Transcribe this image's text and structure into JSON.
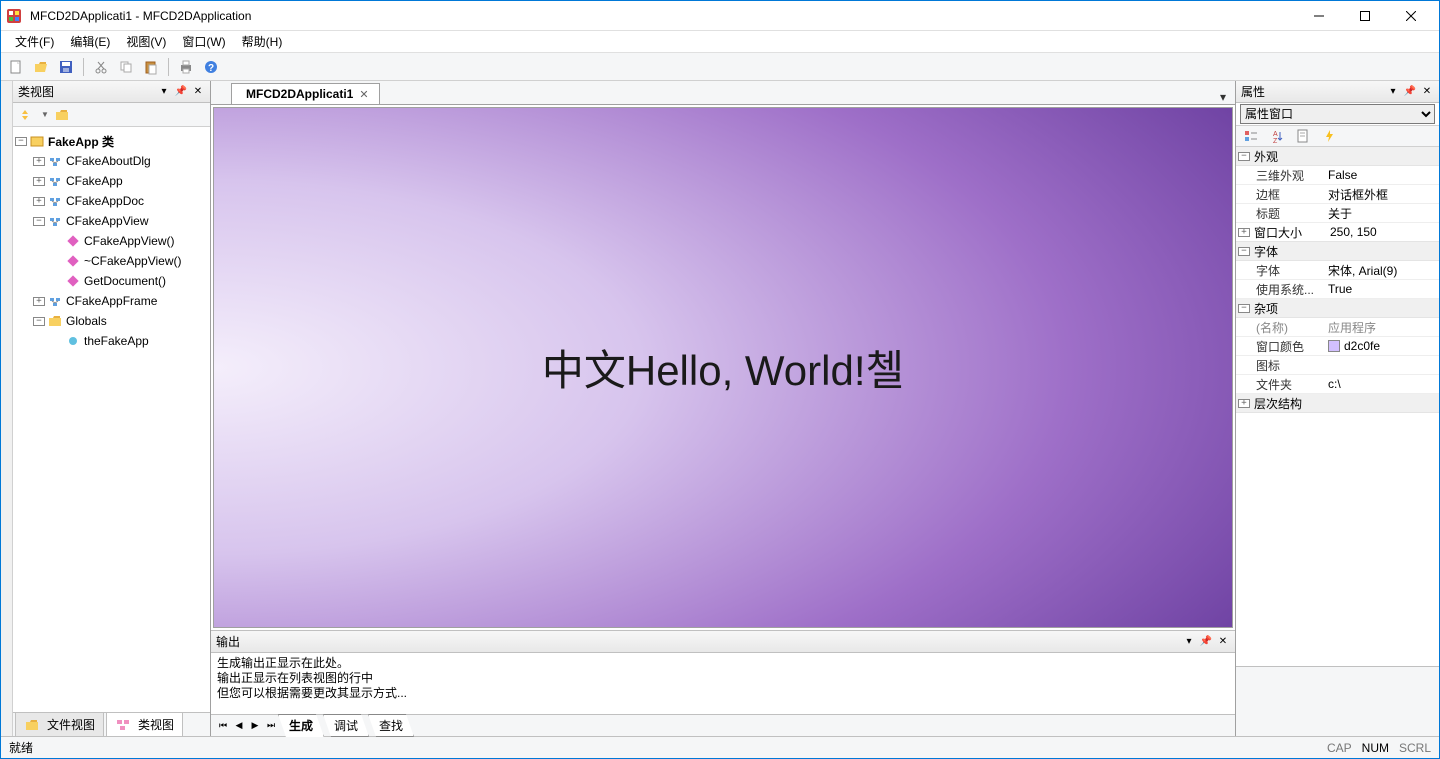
{
  "titlebar": {
    "title": "MFCD2DApplicati1 - MFCD2DApplication"
  },
  "menu": {
    "file": "文件(F)",
    "edit": "编辑(E)",
    "view": "视图(V)",
    "window": "窗口(W)",
    "help": "帮助(H)"
  },
  "classview": {
    "title": "类视图",
    "root": "FakeApp 类",
    "items": [
      {
        "label": "CFakeAboutDlg",
        "indent": 1,
        "exp": "+",
        "kind": "class"
      },
      {
        "label": "CFakeApp",
        "indent": 1,
        "exp": "+",
        "kind": "class"
      },
      {
        "label": "CFakeAppDoc",
        "indent": 1,
        "exp": "+",
        "kind": "class"
      },
      {
        "label": "CFakeAppView",
        "indent": 1,
        "exp": "-",
        "kind": "class"
      },
      {
        "label": "CFakeAppView()",
        "indent": 2,
        "exp": "",
        "kind": "method"
      },
      {
        "label": "~CFakeAppView()",
        "indent": 2,
        "exp": "",
        "kind": "method"
      },
      {
        "label": "GetDocument()",
        "indent": 2,
        "exp": "",
        "kind": "method"
      },
      {
        "label": "CFakeAppFrame",
        "indent": 1,
        "exp": "+",
        "kind": "class"
      },
      {
        "label": "Globals",
        "indent": 1,
        "exp": "-",
        "kind": "folder"
      },
      {
        "label": "theFakeApp",
        "indent": 2,
        "exp": "",
        "kind": "var"
      }
    ],
    "bottom_tabs": {
      "file": "文件视图",
      "class": "类视图"
    }
  },
  "doc": {
    "tab": "MFCD2DApplicati1"
  },
  "canvas": {
    "text": "中文Hello, World!첼"
  },
  "output": {
    "title": "输出",
    "lines": [
      "生成输出正显示在此处。",
      "输出正显示在列表视图的行中",
      "但您可以根据需要更改其显示方式..."
    ],
    "tabs": {
      "build": "生成",
      "debug": "调试",
      "find": "查找"
    }
  },
  "props": {
    "title": "属性",
    "dropdown": "属性窗口",
    "cats": {
      "appearance": "外观",
      "font": "字体",
      "misc": "杂项",
      "hier": "层次结构",
      "winsize": "窗口大小"
    },
    "rows": {
      "threeD": {
        "k": "三维外观",
        "v": "False"
      },
      "border": {
        "k": "边框",
        "v": "对话框外框"
      },
      "caption": {
        "k": "标题",
        "v": "关于"
      },
      "winsize": {
        "k": "窗口大小",
        "v": "250, 150"
      },
      "font": {
        "k": "字体",
        "v": "宋体, Arial(9)"
      },
      "usesys": {
        "k": "使用系统...",
        "v": "True"
      },
      "name": {
        "k": "(名称)",
        "v": "应用程序"
      },
      "wincolor": {
        "k": "窗口颜色",
        "v": "d2c0fe"
      },
      "icon": {
        "k": "图标",
        "v": ""
      },
      "folder": {
        "k": "文件夹",
        "v": "c:\\"
      }
    }
  },
  "status": {
    "ready": "就绪",
    "cap": "CAP",
    "num": "NUM",
    "scrl": "SCRL"
  },
  "colors": {
    "swatch": "#d2c0fe"
  }
}
